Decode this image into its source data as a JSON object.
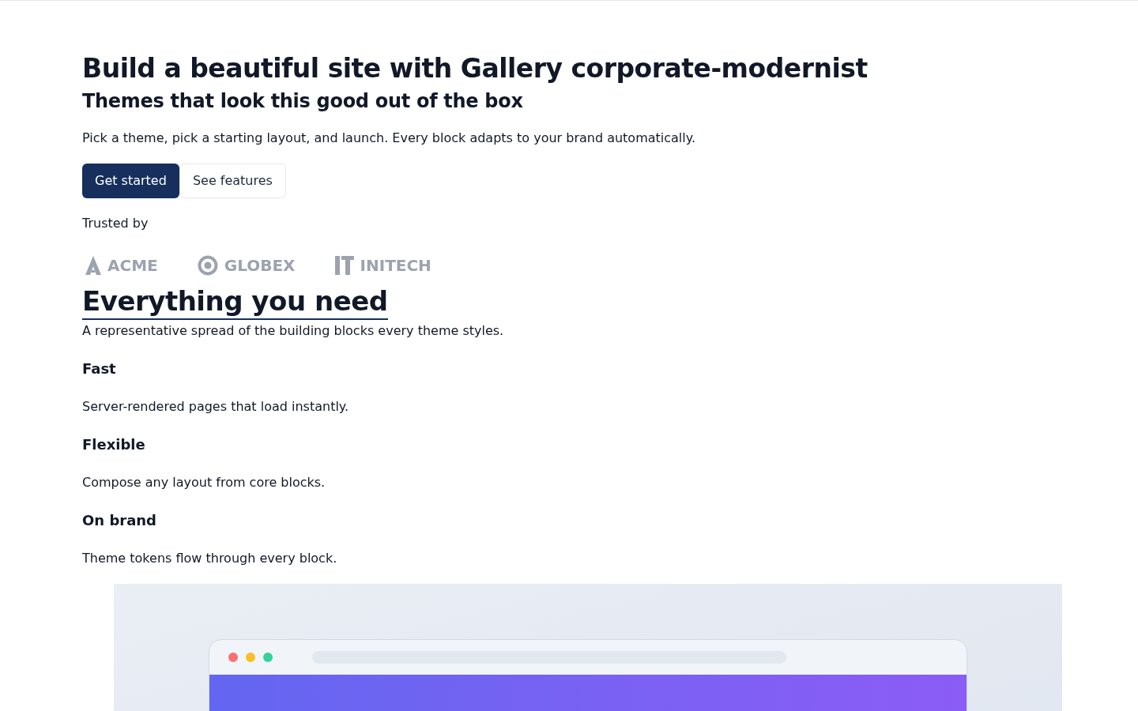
{
  "hero": {
    "title": "Build a beautiful site with Gallery corporate-modernist",
    "subtitle": "Themes that look this good out of the box",
    "lead": "Pick a theme, pick a starting layout, and launch. Every block adapts to your brand automatically.",
    "buttons": [
      {
        "label": "Get started",
        "kind": "primary"
      },
      {
        "label": "See features",
        "kind": "secondary"
      }
    ]
  },
  "trusted": {
    "label": "Trusted by",
    "logos": [
      {
        "name": "ACME",
        "kind": "triangle"
      },
      {
        "name": "GLOBEX",
        "kind": "ring"
      },
      {
        "name": "INITECH",
        "kind": "bars"
      }
    ]
  },
  "features": {
    "title": "Everything you need",
    "intro": "A representative spread of the building blocks every theme styles.",
    "items": [
      {
        "title": "Fast",
        "text": "Server-rendered pages that load instantly."
      },
      {
        "title": "Flexible",
        "text": "Compose any layout from core blocks."
      },
      {
        "title": "On brand",
        "text": "Theme tokens flow through every block."
      }
    ]
  }
}
